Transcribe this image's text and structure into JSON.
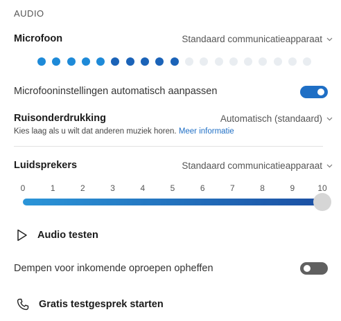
{
  "section": {
    "title": "AUDIO"
  },
  "microphone": {
    "label": "Microfoon",
    "device": "Standaard communicatieapparaat",
    "level_dots_total": 19,
    "level_dots_active": 10,
    "colors": {
      "active": "#1e8ad8",
      "active_dark": "#1b63b8",
      "inactive": "#e9edf1"
    }
  },
  "auto_adjust": {
    "label": "Microfooninstellingen automatisch aanpassen",
    "enabled": true
  },
  "noise": {
    "label": "Ruisonderdrukking",
    "value": "Automatisch (standaard)",
    "description": "Kies laag als u wilt dat anderen muziek horen.",
    "link": "Meer informatie"
  },
  "speakers": {
    "label": "Luidsprekers",
    "device": "Standaard communicatieapparaat",
    "ticks": [
      "0",
      "1",
      "2",
      "3",
      "4",
      "5",
      "6",
      "7",
      "8",
      "9",
      "10"
    ],
    "volume": 10
  },
  "test_audio": {
    "label": "Audio testen"
  },
  "unmute": {
    "label": "Dempen voor inkomende oproepen opheffen",
    "enabled": false
  },
  "test_call": {
    "label": "Gratis testgesprek starten"
  }
}
